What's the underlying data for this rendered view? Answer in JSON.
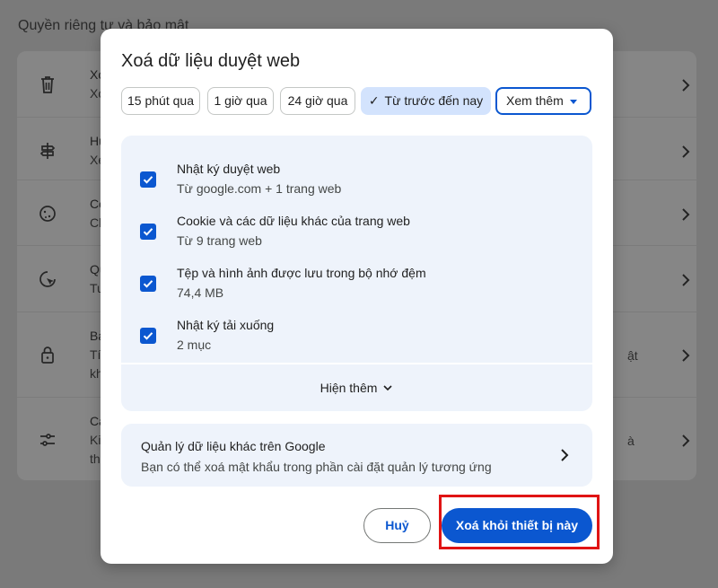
{
  "background": {
    "section_title": "Quyền riêng tư và bảo mật",
    "rows": [
      {
        "icon": "trash-icon",
        "line1": "Xoá c",
        "line2": "Xoá ",
        "line3": "",
        "right": ""
      },
      {
        "icon": "guide-sign-icon",
        "line1": "Hướn",
        "line2": "Xem ",
        "line3": "",
        "right": ""
      },
      {
        "icon": "cookie-icon",
        "line1": "Cook",
        "line2": "Cho ",
        "line3": "",
        "right": ""
      },
      {
        "icon": "permissions-icon",
        "line1": "Quyề",
        "line2": "Tuỳ c",
        "line3": "",
        "right": ""
      },
      {
        "icon": "lock-icon",
        "line1": "Bảo m",
        "line2": "Tính ",
        "line3": "khác",
        "right": "ật"
      },
      {
        "icon": "sliders-icon",
        "line1": "Cài đ",
        "line2": "Kiểm",
        "line3": "thôn",
        "right": "à"
      }
    ]
  },
  "dialog": {
    "title": "Xoá dữ liệu duyệt web",
    "time_ranges": [
      {
        "label": "15 phút qua",
        "selected": false
      },
      {
        "label": "1 giờ qua",
        "selected": false
      },
      {
        "label": "24 giờ qua",
        "selected": false
      },
      {
        "label": "Từ trước đến nay",
        "selected": true
      }
    ],
    "more_dropdown": "Xem thêm",
    "items": [
      {
        "title": "Nhật ký duyệt web",
        "subtitle": "Từ google.com + 1 trang web",
        "checked": true
      },
      {
        "title": "Cookie và các dữ liệu khác của trang web",
        "subtitle": "Từ 9 trang web",
        "checked": true
      },
      {
        "title": "Tệp và hình ảnh được lưu trong bộ nhớ đệm",
        "subtitle": "74,4 MB",
        "checked": true
      },
      {
        "title": "Nhật ký tải xuống",
        "subtitle": "2 mục",
        "checked": true
      }
    ],
    "show_more": "Hiện thêm",
    "manage": {
      "title": "Quản lý dữ liệu khác trên Google",
      "subtitle": "Bạn có thể xoá mật khẩu trong phần cài đặt quản lý tương ứng"
    },
    "cancel_label": "Huỷ",
    "confirm_label": "Xoá khỏi thiết bị này"
  },
  "colors": {
    "accent": "#0b57d0",
    "selected_chip": "#d3e3fd",
    "panel": "#eef3fb",
    "highlight": "#e01414"
  }
}
